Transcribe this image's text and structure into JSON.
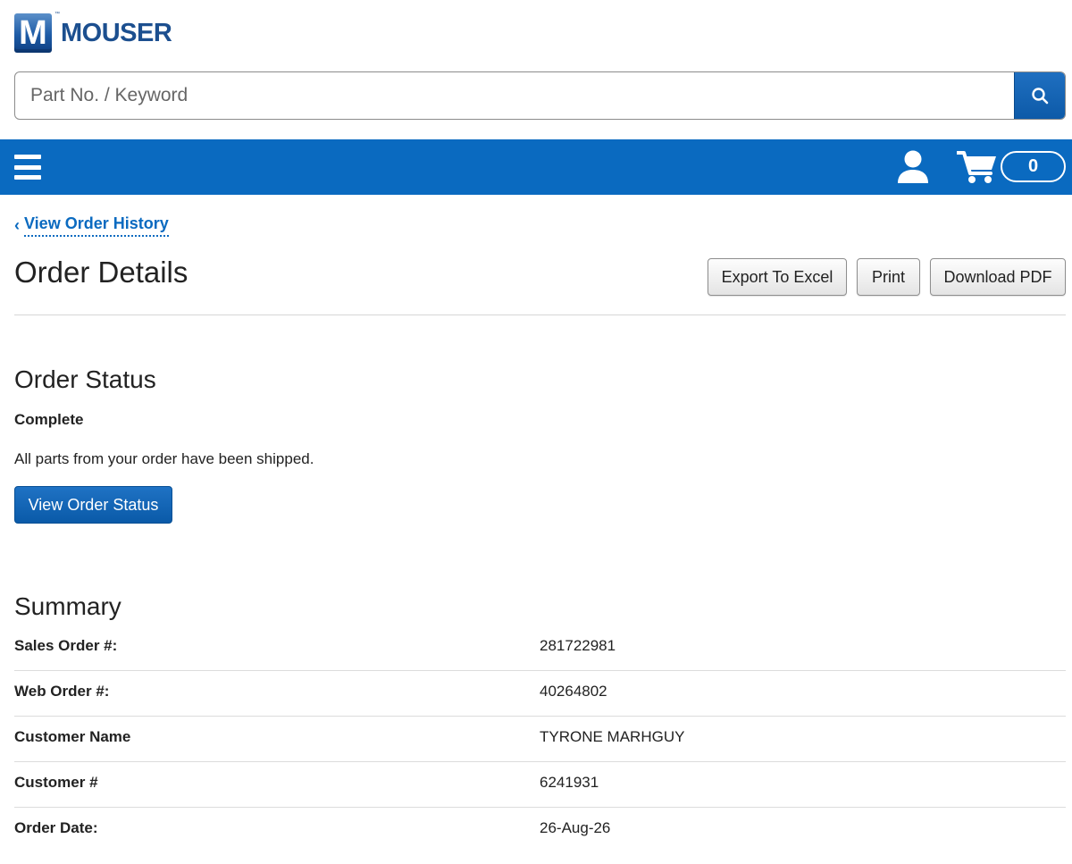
{
  "brand": {
    "logo_letter": "M",
    "logo_text": "MOUSER",
    "trademark": "™",
    "primary_color": "#0a6ac0"
  },
  "search": {
    "placeholder": "Part No. / Keyword",
    "value": "",
    "button_icon": "search-icon"
  },
  "navbar": {
    "menu_icon": "hamburger-icon",
    "account_icon": "user-icon",
    "cart_icon": "cart-icon",
    "cart_count": "0"
  },
  "breadcrumb": {
    "back_label": "View Order History",
    "back_icon": "chevron-left-icon",
    "chevron": "‹"
  },
  "page": {
    "title": "Order Details"
  },
  "toolbar": {
    "export_label": "Export To Excel",
    "print_label": "Print",
    "download_label": "Download PDF"
  },
  "order_status": {
    "heading": "Order Status",
    "status": "Complete",
    "description": "All parts from your order have been shipped.",
    "button_label": "View Order Status"
  },
  "summary": {
    "heading": "Summary",
    "rows": [
      {
        "label": "Sales Order #:",
        "value": "281722981"
      },
      {
        "label": "Web Order #:",
        "value": "40264802"
      },
      {
        "label": "Customer Name",
        "value": "TYRONE MARHGUY"
      },
      {
        "label": "Customer #",
        "value": "6241931"
      },
      {
        "label": "Order Date:",
        "value": "26-Aug-26"
      }
    ]
  }
}
